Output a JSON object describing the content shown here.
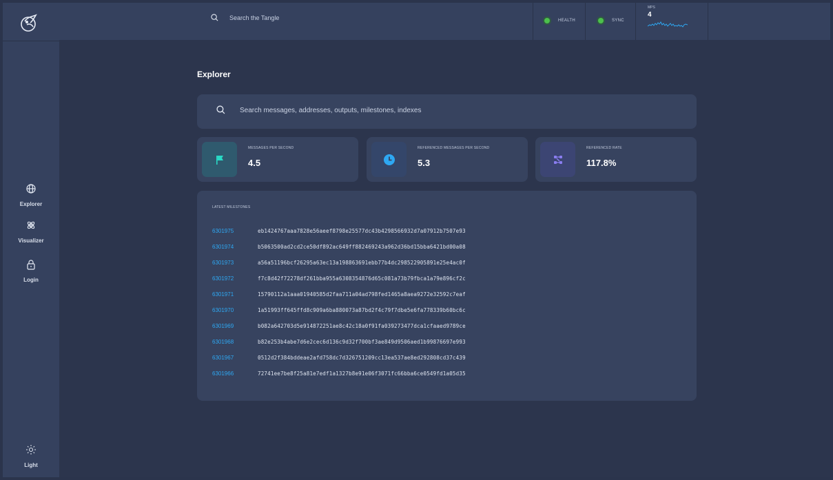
{
  "topbar": {
    "search_placeholder": "Search the Tangle",
    "health_label": "HEALTH",
    "sync_label": "SYNC",
    "mps_label": "MPS",
    "mps_value": "4",
    "health_color": "#4cc04c",
    "sync_color": "#4cc04c",
    "sparkline_color": "#2ea8f3"
  },
  "sidebar": {
    "logo_icon": "hornet-logo-icon",
    "items": [
      {
        "label": "Explorer",
        "icon": "globe-icon"
      },
      {
        "label": "Visualizer",
        "icon": "visualizer-icon"
      },
      {
        "label": "Login",
        "icon": "lock-icon"
      }
    ],
    "theme": {
      "label": "Light",
      "icon": "sun-icon"
    }
  },
  "main": {
    "title": "Explorer",
    "search_placeholder": "Search messages, addresses, outputs, milestones, indexes",
    "cards": [
      {
        "label": "MESSAGES PER SECOND",
        "value": "4.5",
        "icon": "flag-icon",
        "icon_color": "#29d9c5",
        "box_color": "#2f5a6e"
      },
      {
        "label": "REFERENCED MESSAGES PER SECOND",
        "value": "5.3",
        "icon": "clock-icon",
        "icon_color": "#2ea8f3",
        "box_color": "#34466a"
      },
      {
        "label": "REFERENCED RATE",
        "value": "117.8%",
        "icon": "nodes-icon",
        "icon_color": "#8a7df0",
        "box_color": "#3c4573"
      }
    ],
    "milestones_title": "LATEST MILESTONES",
    "milestones": [
      {
        "index": "6301975",
        "hash": "eb1424767aaa7828e56aeef8798e25577dc43b4298566932d7a07912b7507e93"
      },
      {
        "index": "6301974",
        "hash": "b5063500ad2cd2ce50df892ac649ff882469243a962d36bd15bba6421bd00a08"
      },
      {
        "index": "6301973",
        "hash": "a56a51196bcf26295a63ec13a198863691ebb77b4dc298522905891e25e4ac0f"
      },
      {
        "index": "6301972",
        "hash": "f7c8d42f72278df261bba955a6308354876d65c081a73b79fbca1a79e896cf2c"
      },
      {
        "index": "6301971",
        "hash": "15790112a1aaa01940585d2faa711a04ad798fed1465a8aea9272e32592c7eaf"
      },
      {
        "index": "6301970",
        "hash": "1a51993ff645ffd8c909a6ba880073a87bd2f4c79f7dbe5e6fa778339b60bc6c"
      },
      {
        "index": "6301969",
        "hash": "b082a642703d5e914872251ae8c42c18a0f91fa039273477dca1cfaaed9789ce"
      },
      {
        "index": "6301968",
        "hash": "b82e253b4abe7d6e2cec6d136c9d32f700bf3ae849d9506aed1b99876697e993"
      },
      {
        "index": "6301967",
        "hash": "0512d2f384bddeae2afd758dc7d326751209cc13ea537ae8ed292808cd37c439"
      },
      {
        "index": "6301966",
        "hash": "72741ee7be8f25a81e7edf1a1327b8e91e06f3071fc66bba6ce0549fd1a05d35"
      }
    ]
  }
}
